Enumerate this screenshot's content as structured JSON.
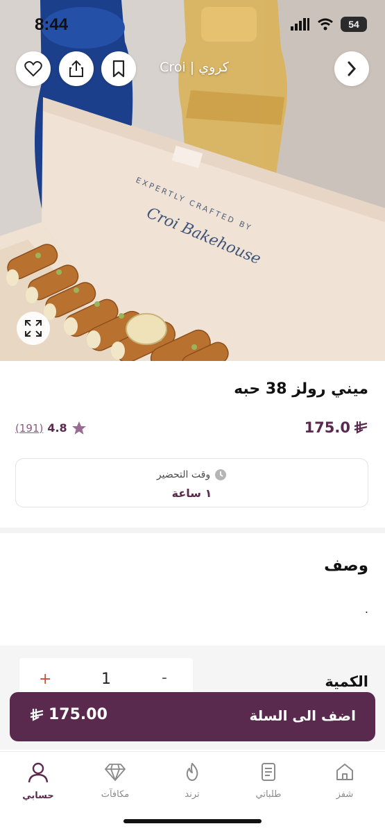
{
  "status_bar": {
    "time": "8:44",
    "battery": "54"
  },
  "header": {
    "store_name": "كروي | Croi"
  },
  "product": {
    "title": "ميني رولز 38 حبه",
    "price": "175.0",
    "rating": "4.8",
    "rating_count": "(191)"
  },
  "prep": {
    "label": "وقت التحضير",
    "value": "١ ساعة"
  },
  "description": {
    "title": "وصف",
    "text": "."
  },
  "quantity": {
    "label": "الكمية",
    "value": "1",
    "minus": "-",
    "plus": "+"
  },
  "cart": {
    "label": "اضف الى السلة",
    "price": "175.00"
  },
  "hero_text": {
    "line1": "EXPERTLY CRAFTED BY",
    "line2": "Croi Bakehouse"
  },
  "nav": {
    "items": [
      {
        "label": "شفز",
        "icon": "home-icon"
      },
      {
        "label": "طلباتي",
        "icon": "orders-icon"
      },
      {
        "label": "ترند",
        "icon": "trend-icon"
      },
      {
        "label": "مكافآت",
        "icon": "diamond-icon"
      },
      {
        "label": "حسابي",
        "icon": "account-icon"
      }
    ]
  },
  "colors": {
    "brand": "#5a2a4e",
    "plus_red": "#d24a3a",
    "panel": "#f5f5f5"
  }
}
